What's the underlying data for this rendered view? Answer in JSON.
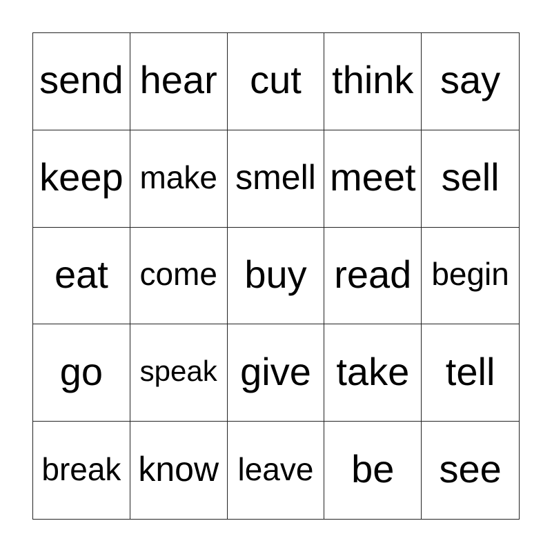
{
  "board": {
    "rows": [
      [
        "send",
        "hear",
        "cut",
        "think",
        "say"
      ],
      [
        "keep",
        "make",
        "smell",
        "meet",
        "sell"
      ],
      [
        "eat",
        "come",
        "buy",
        "read",
        "begin"
      ],
      [
        "go",
        "speak",
        "give",
        "take",
        "tell"
      ],
      [
        "break",
        "know",
        "leave",
        "be",
        "see"
      ]
    ]
  }
}
